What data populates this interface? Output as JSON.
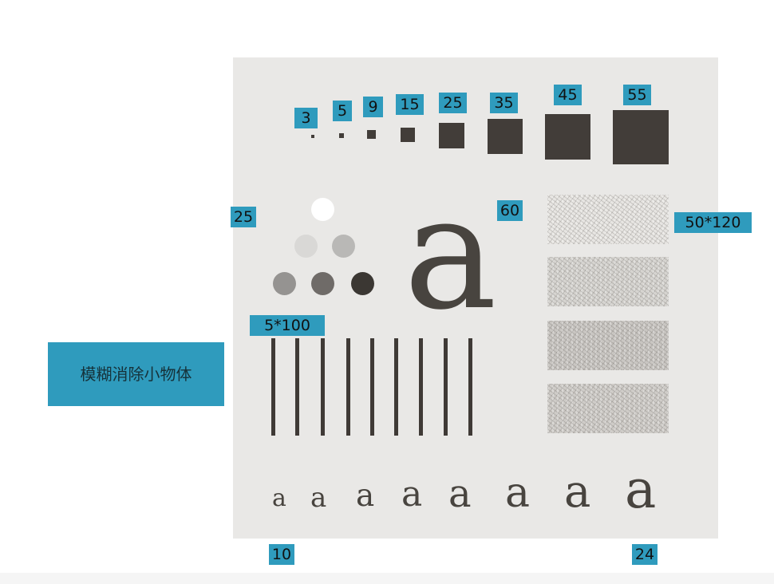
{
  "side_label": "模糊消除小物体",
  "square_labels": [
    "3",
    "5",
    "9",
    "15",
    "25",
    "35",
    "45",
    "55"
  ],
  "circles_label": "25",
  "letter_label": "60",
  "noise_label": "50*120",
  "bars_label": "5*100",
  "letters_start_label": "10",
  "letters_end_label": "24",
  "big_letter": "a",
  "small_letters": [
    "a",
    "a",
    "a",
    "a",
    "a",
    "a",
    "a",
    "a"
  ],
  "colors": {
    "label_bg": "#2f9bbd",
    "panel_bg": "#e9e8e6",
    "ink": "#423d39"
  }
}
